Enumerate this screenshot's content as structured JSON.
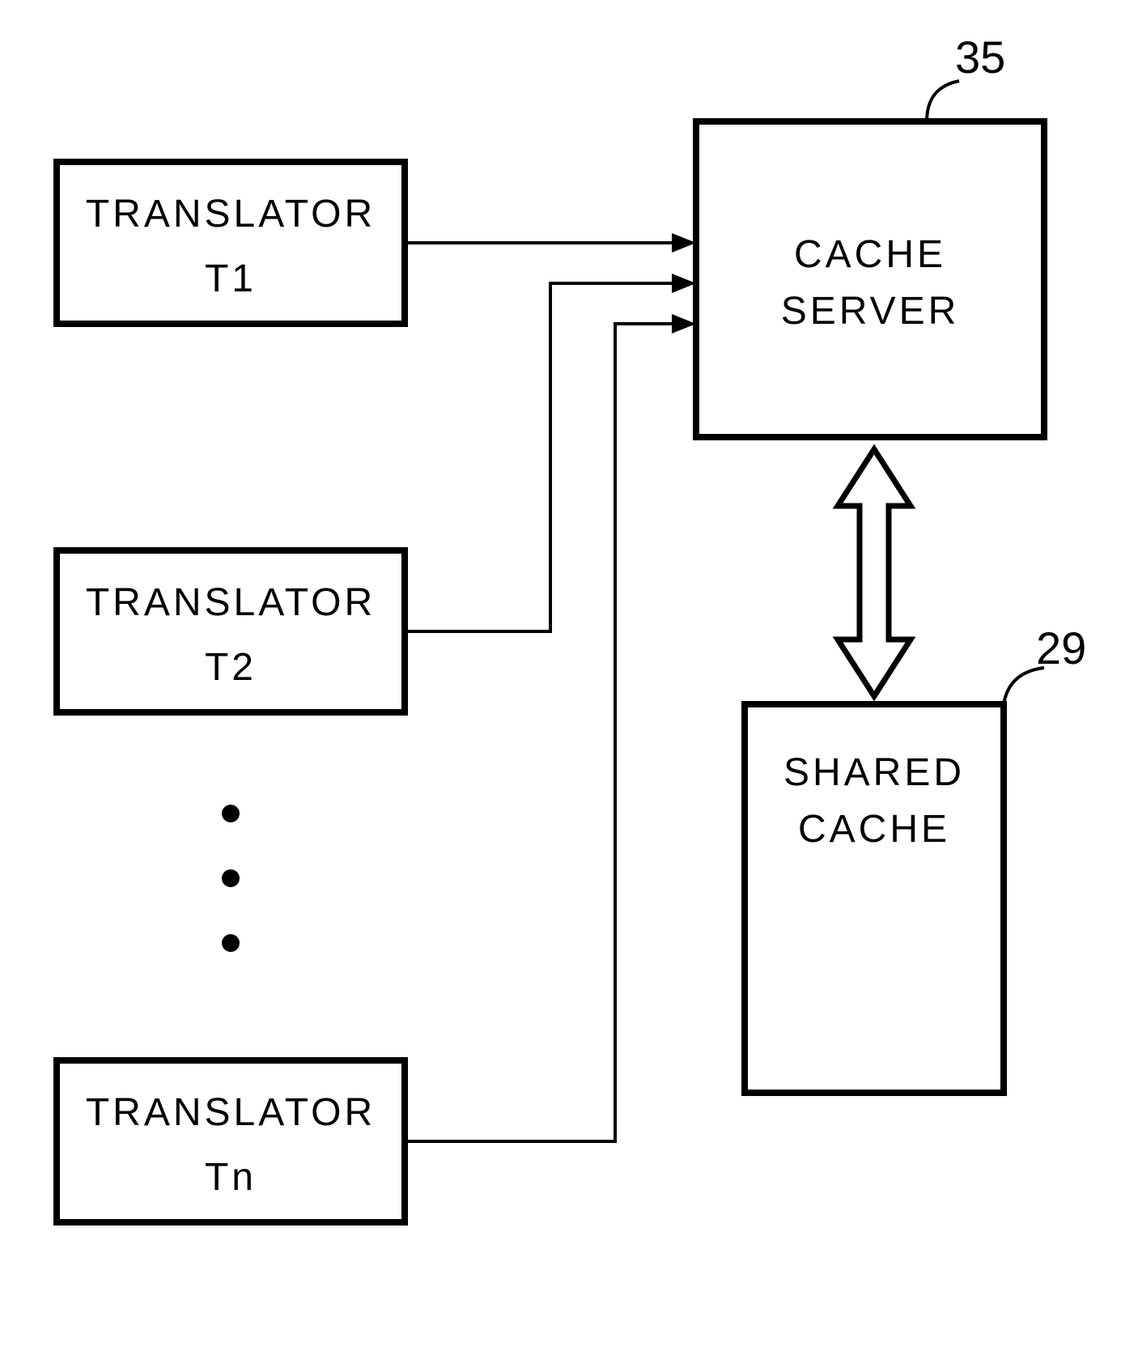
{
  "labels": {
    "cache_server_num": "35",
    "shared_cache_num": "29",
    "cache_server_line1": "CACHE",
    "cache_server_line2": "SERVER",
    "shared_cache_line1": "SHARED",
    "shared_cache_line2": "CACHE",
    "translator_word": "TRANSLATOR",
    "t1": "T1",
    "t2": "T2",
    "tn": "Tn"
  }
}
